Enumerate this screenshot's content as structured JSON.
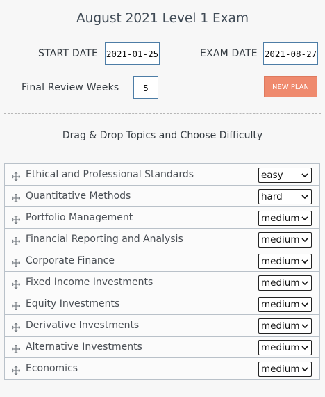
{
  "title": "August 2021 Level 1 Exam",
  "start": {
    "label": "START DATE",
    "value": "2021-01-25"
  },
  "exam": {
    "label": "EXAM DATE",
    "value": "2021-08-27"
  },
  "review": {
    "label": "Final Review Weeks",
    "value": "5"
  },
  "new_plan_label": "NEW PLAN",
  "subtitle": "Drag & Drop Topics and Choose Difficulty",
  "topics": [
    {
      "name": "Ethical and Professional Standards",
      "difficulty": "easy"
    },
    {
      "name": "Quantitative Methods",
      "difficulty": "hard"
    },
    {
      "name": "Portfolio Management",
      "difficulty": "medium"
    },
    {
      "name": "Financial Reporting and Analysis",
      "difficulty": "medium"
    },
    {
      "name": "Corporate Finance",
      "difficulty": "medium"
    },
    {
      "name": "Fixed Income Investments",
      "difficulty": "medium"
    },
    {
      "name": "Equity Investments",
      "difficulty": "medium"
    },
    {
      "name": "Derivative Investments",
      "difficulty": "medium"
    },
    {
      "name": "Alternative Investments",
      "difficulty": "medium"
    },
    {
      "name": "Economics",
      "difficulty": "medium"
    }
  ],
  "colors": {
    "accent": "#ef8a6e",
    "input_border": "#4d7da6"
  }
}
